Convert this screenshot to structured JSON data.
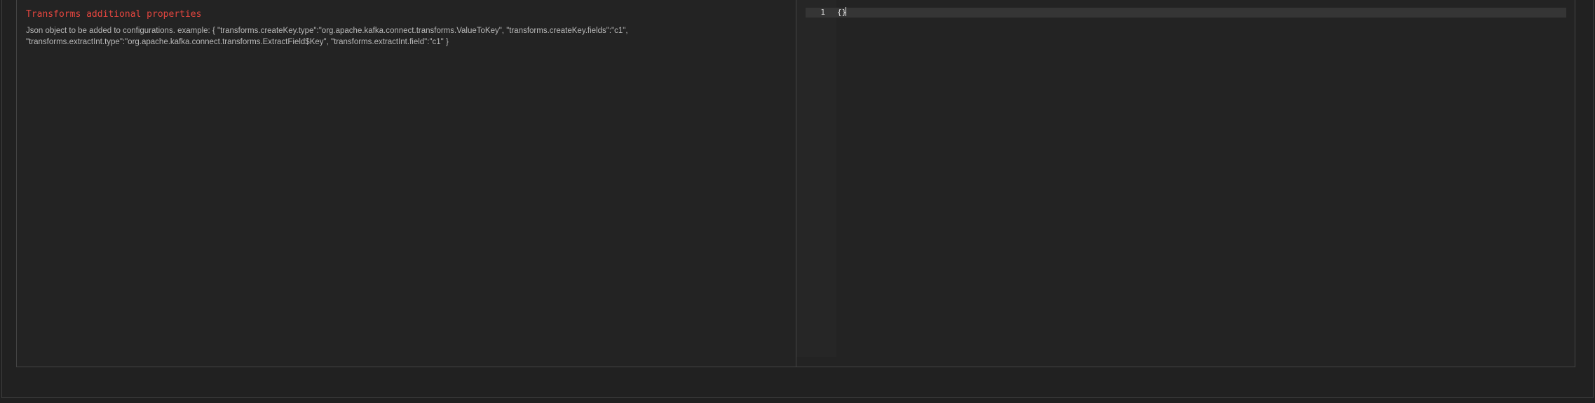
{
  "property": {
    "title": "Transforms additional properties",
    "description": "Json object to be added to configurations. example: { \"transforms.createKey.type\":\"org.apache.kafka.connect.transforms.ValueToKey\", \"transforms.createKey.fields\":\"c1\", \"transforms.extractInt.type\":\"org.apache.kafka.connect.transforms.ExtractField$Key\", \"transforms.extractInt.field\":\"c1\" }"
  },
  "editor": {
    "lines": [
      {
        "number": "1",
        "content": "{}"
      }
    ]
  },
  "colors": {
    "title": "#e5463f",
    "background": "#232323",
    "border": "#444444"
  }
}
